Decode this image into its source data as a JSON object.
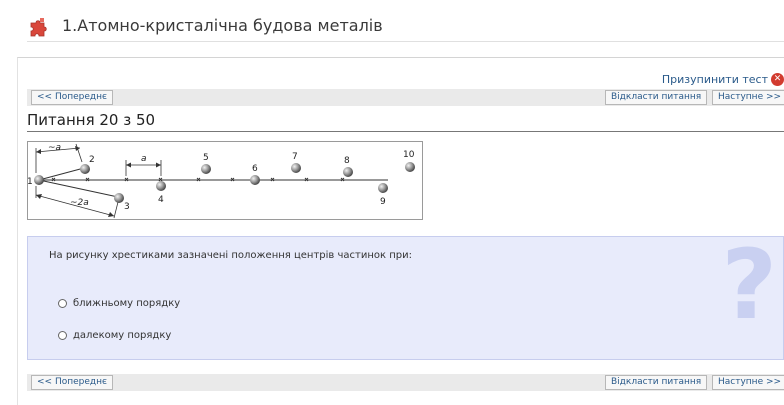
{
  "header": {
    "title": "1.Атомно-кристалічна будова металів",
    "icon": "puzzle-icon",
    "icon_color": "#d9473b"
  },
  "toolbar": {
    "pause_label": "Призупинити тест",
    "pause_icon": "close-circle-icon",
    "prev_label": "<< Попереднє",
    "defer_label": "Відкласти питання",
    "next_label": "Наступне >>"
  },
  "question": {
    "counter": "Питання 20 з 50",
    "text": "На рисунку хрестиками зазначені положення центрів частинок при:",
    "options": [
      {
        "label": "ближньому порядку"
      },
      {
        "label": "далекому порядку"
      }
    ],
    "figure": {
      "labels": [
        "1",
        "2",
        "3",
        "4",
        "5",
        "6",
        "7",
        "8",
        "9",
        "10"
      ],
      "dist_a_near": "~a",
      "dist_2a": "~2a",
      "dist_a": "a"
    }
  },
  "colors": {
    "link": "#2a5a8a",
    "question_bg": "#e8ebfb",
    "question_mark": "#c9d0f1"
  }
}
